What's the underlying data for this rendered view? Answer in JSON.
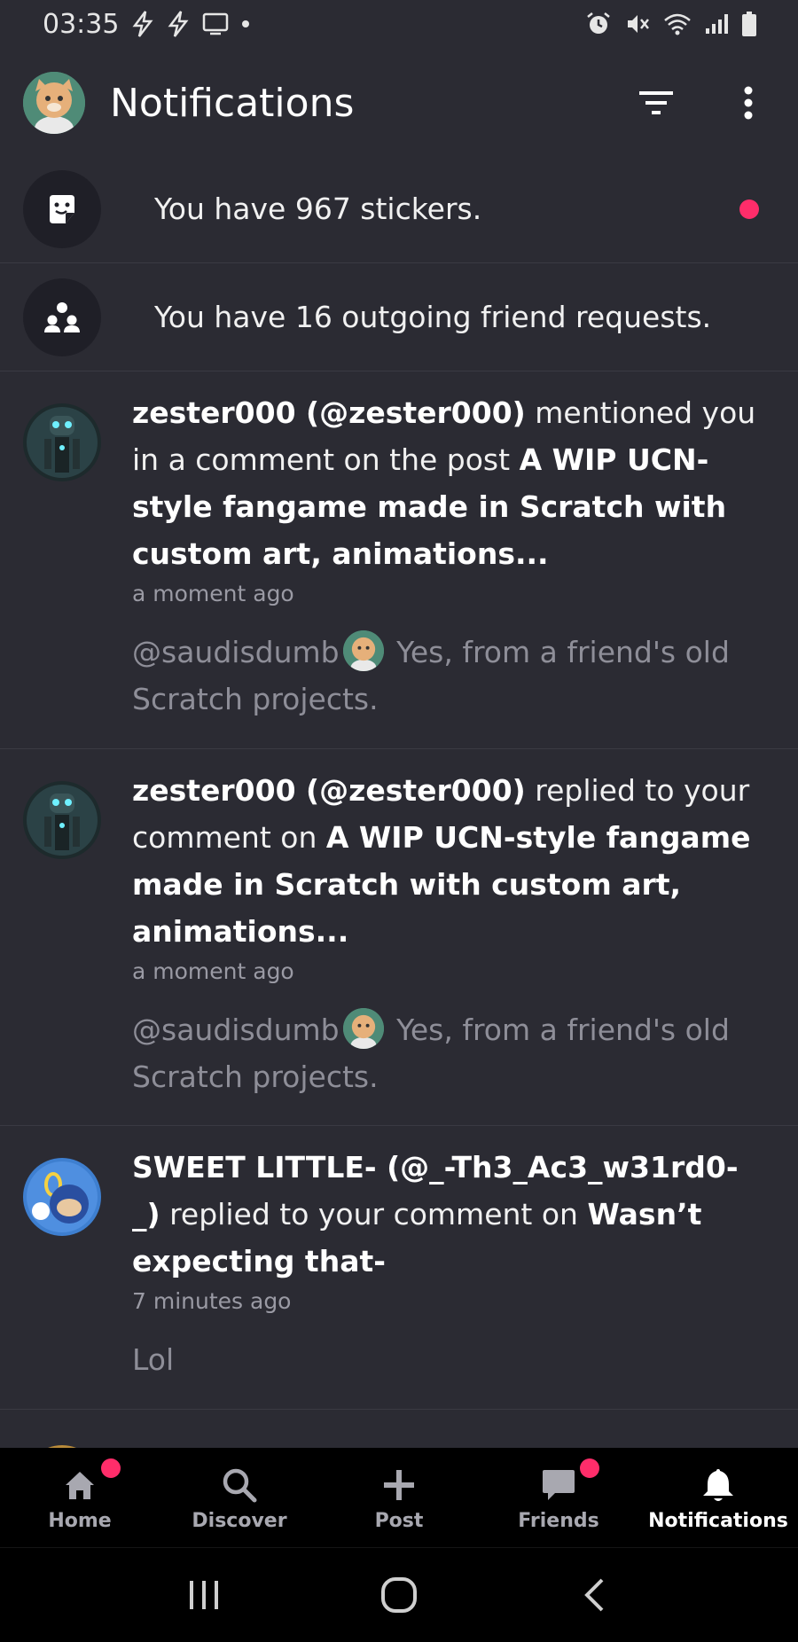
{
  "status_bar": {
    "time": "03:35",
    "left_icons": [
      "flash-icon",
      "flash-icon",
      "cast-icon",
      "dot-icon"
    ],
    "right_icons": [
      "alarm-icon",
      "mute-icon",
      "wifi-icon",
      "signal-icon",
      "battery-icon"
    ]
  },
  "header": {
    "title": "Notifications",
    "avatar": "user-avatar",
    "actions": [
      "filter-icon",
      "more-icon"
    ]
  },
  "system_items": [
    {
      "text": "You have 967 stickers.",
      "icon": "sticker-icon",
      "unread": true
    },
    {
      "text": "You have 16 outgoing friend requests.",
      "icon": "group-icon",
      "unread": false
    }
  ],
  "notifications": [
    {
      "actor": "zester000 (@zester000)",
      "action": " mentioned you in a comment on the post ",
      "target": "A WIP UCN-style fangame made in Scratch with custom art, animations...",
      "time": "a moment ago",
      "comment_mention": "@saudisdumb",
      "comment_text": " Yes, from a friend's old Scratch projects."
    },
    {
      "actor": "zester000 (@zester000)",
      "action": " replied to your comment on ",
      "target": "A WIP UCN-style fangame made in Scratch with custom art, animations...",
      "time": "a moment ago",
      "comment_mention": "@saudisdumb",
      "comment_text": " Yes, from a friend's old Scratch projects."
    },
    {
      "actor": "SWEET LITTLE- (@_-Th3_Ac3_w31rd0-_)",
      "action": " replied to your comment on ",
      "target": "Wasn’t expecting that-",
      "time": "7 minutes ago",
      "comment_text": "Lol"
    }
  ],
  "bottom_nav": [
    {
      "label": "Home",
      "icon": "home-icon",
      "badge": true
    },
    {
      "label": "Discover",
      "icon": "search-icon",
      "badge": false
    },
    {
      "label": "Post",
      "icon": "plus-icon",
      "badge": false
    },
    {
      "label": "Friends",
      "icon": "chat-icon",
      "badge": true
    },
    {
      "label": "Notifications",
      "icon": "bell-icon",
      "badge": false,
      "active": true
    }
  ],
  "system_nav": [
    "recents-icon",
    "home-circle-icon",
    "back-icon"
  ],
  "colors": {
    "background": "#2b2b33",
    "accent": "#ff2d6a",
    "nav_bg": "#000000"
  }
}
